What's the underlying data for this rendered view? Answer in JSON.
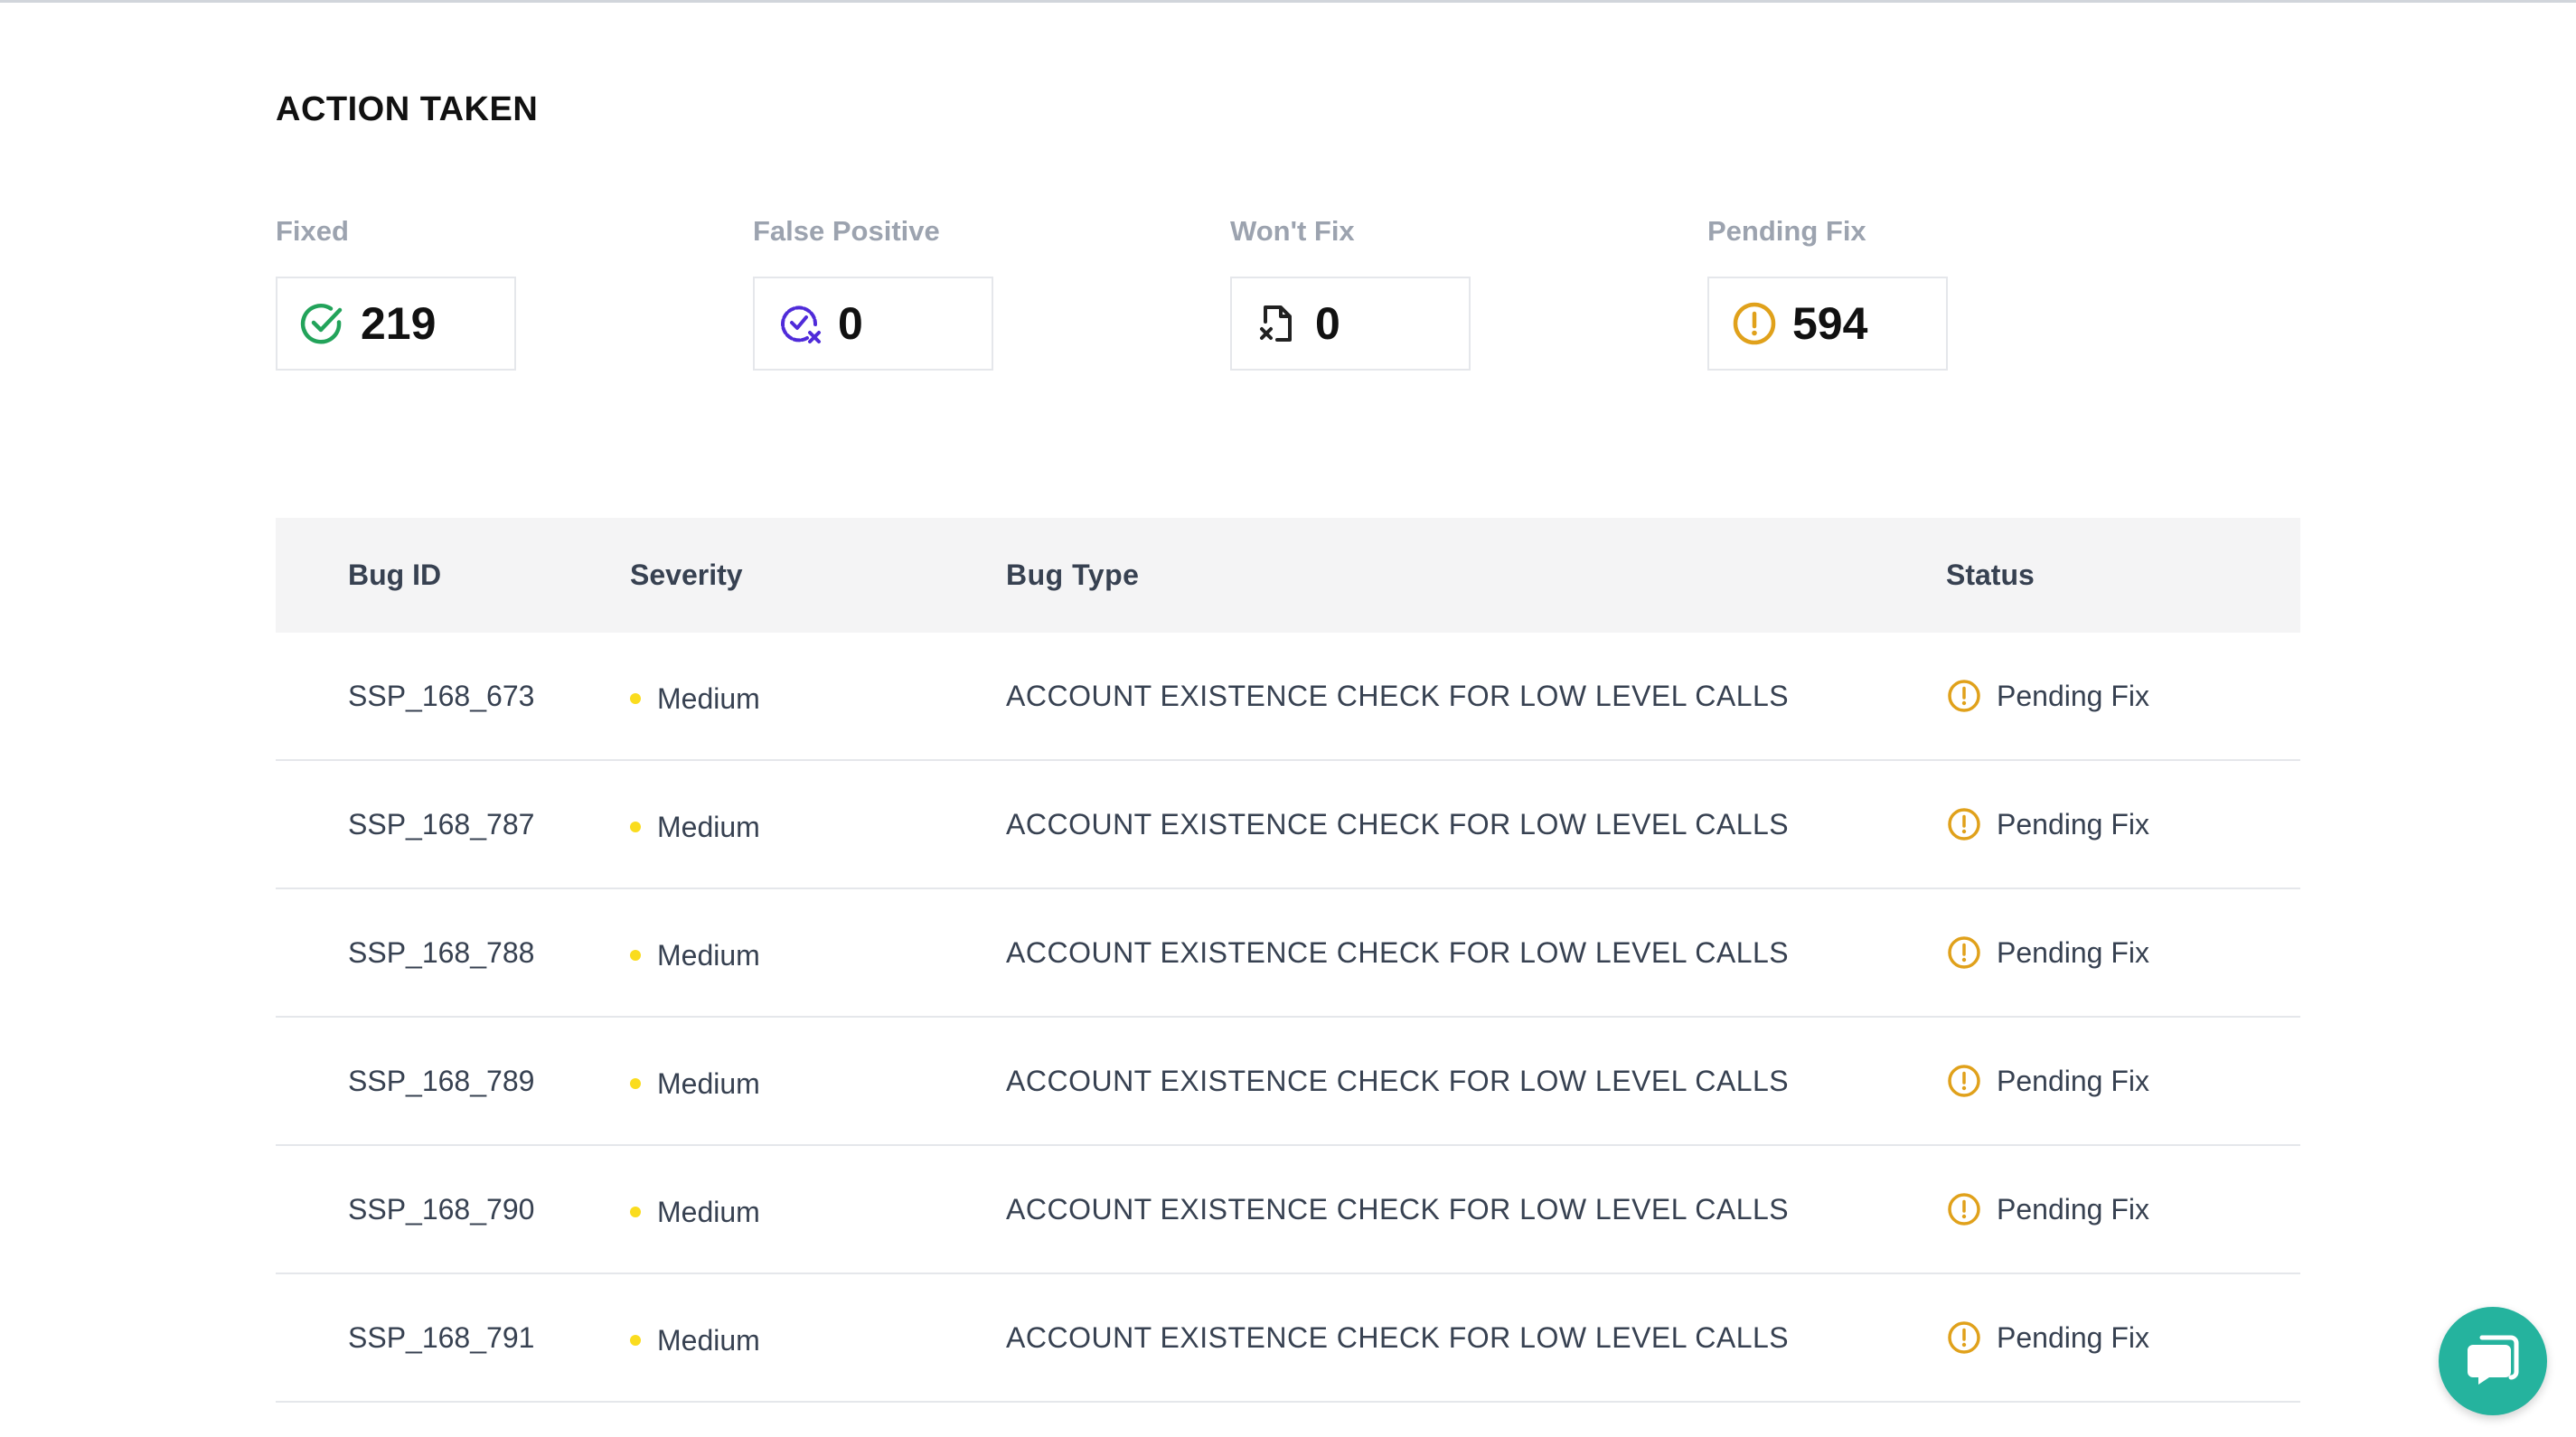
{
  "section": {
    "title": "ACTION TAKEN"
  },
  "stats": [
    {
      "label": "Fixed",
      "value": "219",
      "icon": "check-circle-icon",
      "color": "#22a35a"
    },
    {
      "label": "False Positive",
      "value": "0",
      "icon": "false-positive-icon",
      "color": "#4f2bd9"
    },
    {
      "label": "Won't Fix",
      "value": "0",
      "icon": "file-x-icon",
      "color": "#222222"
    },
    {
      "label": "Pending Fix",
      "value": "594",
      "icon": "alert-circle-icon",
      "color": "#e0a11b"
    }
  ],
  "table": {
    "headers": {
      "bug_id": "Bug ID",
      "severity": "Severity",
      "bug_type": "Bug Type",
      "status": "Status"
    },
    "rows": [
      {
        "bug_id": "SSP_168_673",
        "severity": "Medium",
        "bug_type": "ACCOUNT EXISTENCE CHECK FOR LOW LEVEL CALLS",
        "status": "Pending Fix"
      },
      {
        "bug_id": "SSP_168_787",
        "severity": "Medium",
        "bug_type": "ACCOUNT EXISTENCE CHECK FOR LOW LEVEL CALLS",
        "status": "Pending Fix"
      },
      {
        "bug_id": "SSP_168_788",
        "severity": "Medium",
        "bug_type": "ACCOUNT EXISTENCE CHECK FOR LOW LEVEL CALLS",
        "status": "Pending Fix"
      },
      {
        "bug_id": "SSP_168_789",
        "severity": "Medium",
        "bug_type": "ACCOUNT EXISTENCE CHECK FOR LOW LEVEL CALLS",
        "status": "Pending Fix"
      },
      {
        "bug_id": "SSP_168_790",
        "severity": "Medium",
        "bug_type": "ACCOUNT EXISTENCE CHECK FOR LOW LEVEL CALLS",
        "status": "Pending Fix"
      },
      {
        "bug_id": "SSP_168_791",
        "severity": "Medium",
        "bug_type": "ACCOUNT EXISTENCE CHECK FOR LOW LEVEL CALLS",
        "status": "Pending Fix"
      }
    ]
  },
  "colors": {
    "severity_medium": "#fadc1e",
    "pending": "#e0a11b",
    "chat": "#25b39e"
  },
  "chat": {
    "icon": "chat-bubble-icon"
  }
}
